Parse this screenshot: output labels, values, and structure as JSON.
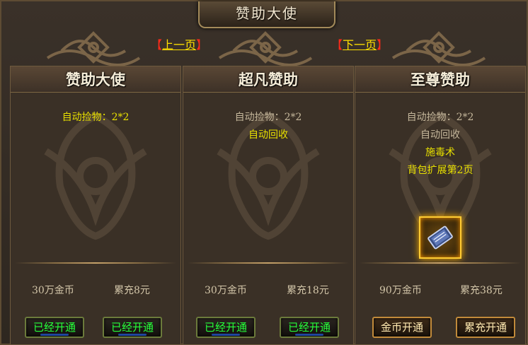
{
  "window": {
    "title": "赞助大使"
  },
  "pager": {
    "prev": "上一页",
    "next": "下一页",
    "bracket_l": "【",
    "bracket_r": "】"
  },
  "colors": {
    "accent_yellow": "#e8e000",
    "active_green": "#26ff3a",
    "pager_red": "#ff2a1a",
    "frame_gold": "#a38a5a"
  },
  "panels": [
    {
      "title": "赞助大使",
      "features": [
        "自动捡物：2*2"
      ],
      "price_gold": "30万金币",
      "price_recharge": "累充8元",
      "btn_gold": "已经开通",
      "btn_recharge": "已经开通"
    },
    {
      "title": "超凡赞助",
      "features": [
        "自动捡物：2*2",
        "自动回收"
      ],
      "price_gold": "30万金币",
      "price_recharge": "累充18元",
      "btn_gold": "已经开通",
      "btn_recharge": "已经开通"
    },
    {
      "title": "至尊赞助",
      "features": [
        "自动捡物：2*2",
        "自动回收",
        "施毒术",
        "背包扩展第2页"
      ],
      "price_gold": "90万金币",
      "price_recharge": "累充38元",
      "btn_gold": "金币开通",
      "btn_recharge": "累充开通",
      "reward_item": {
        "icon": "skill-book-icon"
      }
    }
  ]
}
